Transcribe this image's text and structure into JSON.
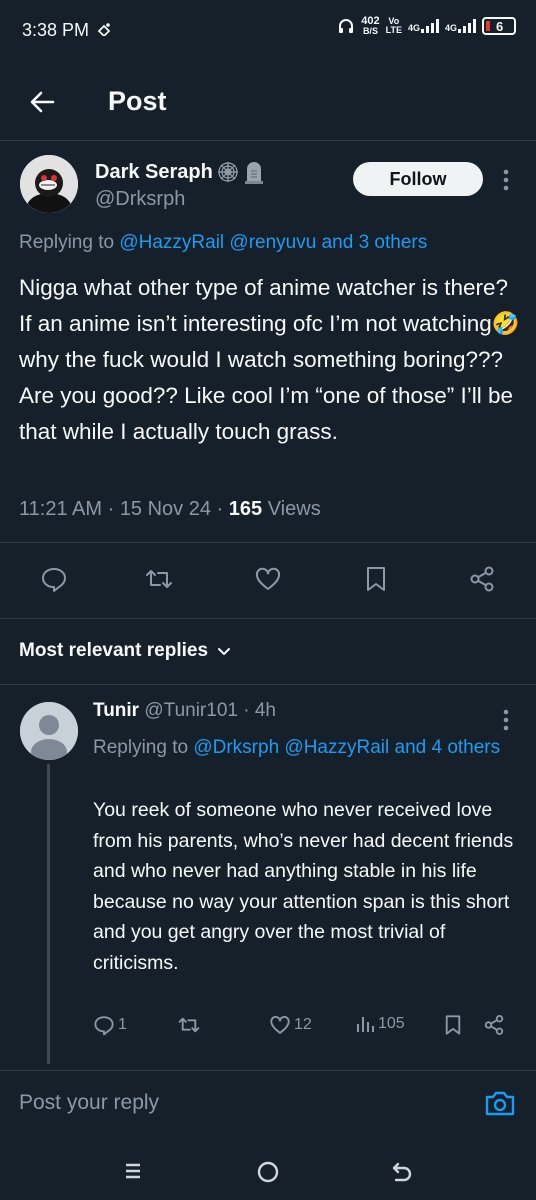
{
  "status_bar": {
    "time": "3:38 PM",
    "net_speed_value": "402",
    "net_speed_unit": "B/S",
    "volte_top": "Vo",
    "volte_bottom": "LTE",
    "sim1": "4G",
    "sim2": "4G",
    "battery": "6",
    "battery_color": "#e53935"
  },
  "header": {
    "title": "Post"
  },
  "tweet": {
    "author_name": "Dark Seraph",
    "author_handle": "@Drksrph",
    "follow_label": "Follow",
    "replying_prefix": "Replying to",
    "replying_to": "@HazzyRail @renyuvu and 3 others",
    "text": "Nigga what other type of anime watcher is there? If an anime isn’t interesting ofc I’m not watching🤣 why the fuck would I watch something boring??? Are you good?? Like cool I’m “one of those” I’ll be that while I actually touch grass.",
    "time": "11:21 AM",
    "date": "15 Nov 24",
    "views_count": "165",
    "views_label": "Views"
  },
  "replies_sort": {
    "label": "Most relevant replies"
  },
  "reply": {
    "name": "Tunir",
    "handle": "@Tunir101",
    "age": "4h",
    "replying_prefix": "Replying to",
    "replying_to": "@Drksrph @HazzyRail and 4 others",
    "text": "You reek of someone who never received love from his parents, who’s never had decent friends and who never had anything stable in his life because no way your attention span is this short and you get angry over the most trivial of criticisms.",
    "reply_count": "1",
    "repost_count": "",
    "like_count": "12",
    "view_count": "105"
  },
  "compose": {
    "placeholder": "Post your reply"
  },
  "colors": {
    "background": "#15202b",
    "accent": "#1d9bf0",
    "muted": "#8b98a5",
    "divider": "#2f3a44"
  },
  "icons": [
    "back-arrow-icon",
    "spider-web-icon",
    "tombstone-icon",
    "more-vertical-icon",
    "reply-icon",
    "repost-icon",
    "like-icon",
    "bookmark-icon",
    "share-icon",
    "chevron-down-icon",
    "views-icon",
    "camera-icon",
    "recents-icon",
    "home-icon",
    "back-nav-icon"
  ]
}
